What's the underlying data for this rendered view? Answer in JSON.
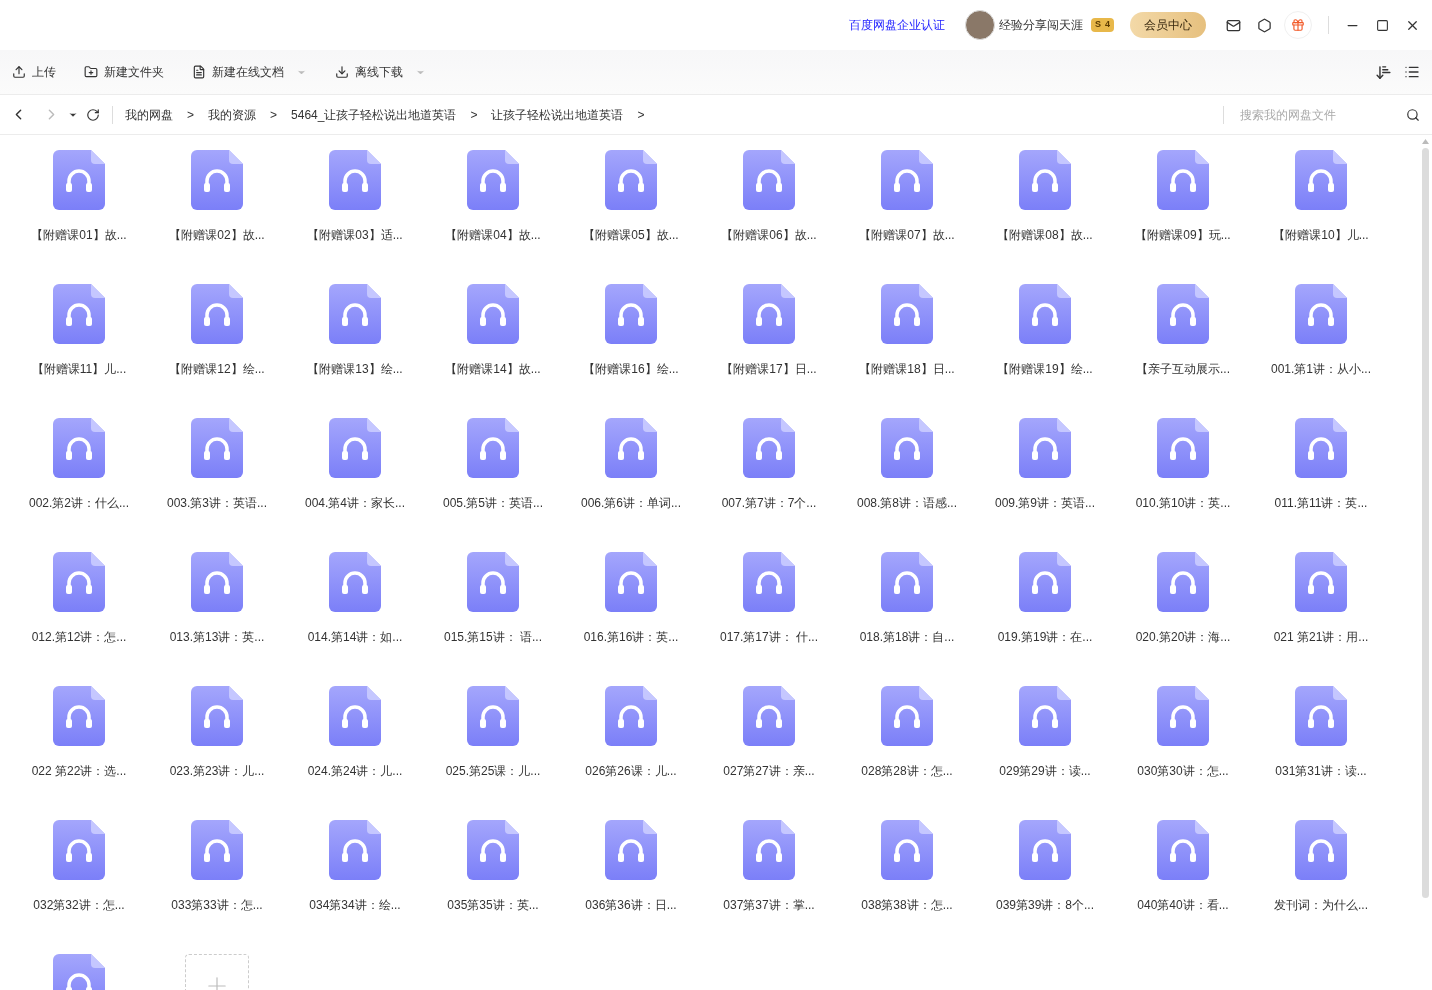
{
  "header": {
    "enterprise_link": "百度网盘企业认证",
    "user_name": "经验分享闯天涯",
    "badge": {
      "letter": "S",
      "level": "4"
    },
    "member_button": "会员中心"
  },
  "toolbar": {
    "buttons": [
      {
        "label": "上传",
        "kind": "upload",
        "dropdown": false
      },
      {
        "label": "新建文件夹",
        "kind": "folder",
        "dropdown": false
      },
      {
        "label": "新建在线文档",
        "kind": "doc",
        "dropdown": true
      },
      {
        "label": "离线下载",
        "kind": "download",
        "dropdown": true
      }
    ]
  },
  "breadcrumb": {
    "items": [
      "我的网盘",
      "我的资源",
      "5464_让孩子轻松说出地道英语",
      "让孩子轻松说出地道英语"
    ],
    "separator": ">"
  },
  "search": {
    "placeholder": "搜索我的网盘文件"
  },
  "files": [
    {
      "name": "【附赠课01】故..."
    },
    {
      "name": "【附赠课02】故..."
    },
    {
      "name": "【附赠课03】适..."
    },
    {
      "name": "【附赠课04】故..."
    },
    {
      "name": "【附赠课05】故..."
    },
    {
      "name": "【附赠课06】故..."
    },
    {
      "name": "【附赠课07】故..."
    },
    {
      "name": "【附赠课08】故..."
    },
    {
      "name": "【附赠课09】玩..."
    },
    {
      "name": "【附赠课10】儿..."
    },
    {
      "name": "【附赠课11】儿..."
    },
    {
      "name": "【附赠课12】绘..."
    },
    {
      "name": "【附赠课13】绘..."
    },
    {
      "name": "【附赠课14】故..."
    },
    {
      "name": "【附赠课16】绘..."
    },
    {
      "name": "【附赠课17】日..."
    },
    {
      "name": "【附赠课18】日..."
    },
    {
      "name": "【附赠课19】绘..."
    },
    {
      "name": "【亲子互动展示..."
    },
    {
      "name": "001.第1讲：从小..."
    },
    {
      "name": "002.第2讲：什么..."
    },
    {
      "name": "003.第3讲：英语..."
    },
    {
      "name": "004.第4讲：家长..."
    },
    {
      "name": "005.第5讲：英语..."
    },
    {
      "name": "006.第6讲：单词..."
    },
    {
      "name": "007.第7讲：7个..."
    },
    {
      "name": "008.第8讲：语感..."
    },
    {
      "name": "009.第9讲：英语..."
    },
    {
      "name": "010.第10讲：英..."
    },
    {
      "name": "011.第11讲：英..."
    },
    {
      "name": "012.第12讲：怎..."
    },
    {
      "name": "013.第13讲：英..."
    },
    {
      "name": "014.第14讲：如..."
    },
    {
      "name": "015.第15讲： 语..."
    },
    {
      "name": "016.第16讲：英..."
    },
    {
      "name": "017.第17讲： 什..."
    },
    {
      "name": "018.第18讲：自..."
    },
    {
      "name": "019.第19讲：在..."
    },
    {
      "name": "020.第20讲：海..."
    },
    {
      "name": "021 第21讲：用..."
    },
    {
      "name": "022 第22讲：选..."
    },
    {
      "name": "023.第23讲：儿..."
    },
    {
      "name": "024.第24讲：儿..."
    },
    {
      "name": "025.第25课：儿..."
    },
    {
      "name": "026第26课：儿..."
    },
    {
      "name": "027第27讲：亲..."
    },
    {
      "name": "028第28讲：怎..."
    },
    {
      "name": "029第29讲：读..."
    },
    {
      "name": "030第30讲：怎..."
    },
    {
      "name": "031第31讲：读..."
    },
    {
      "name": "032第32讲：怎..."
    },
    {
      "name": "033第33讲：怎..."
    },
    {
      "name": "034第34讲：绘..."
    },
    {
      "name": "035第35讲：英..."
    },
    {
      "name": "036第36讲：日..."
    },
    {
      "name": "037第37讲：掌..."
    },
    {
      "name": "038第38讲：怎..."
    },
    {
      "name": "039第39讲：8个..."
    },
    {
      "name": "040第40讲：看..."
    },
    {
      "name": "发刊词：为什么..."
    },
    {
      "kind": "audio"
    },
    {
      "kind": "new"
    }
  ]
}
